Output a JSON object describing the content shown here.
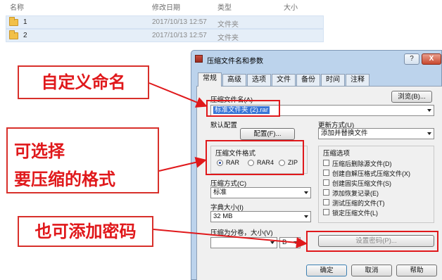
{
  "explorer": {
    "columns": {
      "name": "名称",
      "modified": "修改日期",
      "type": "类型",
      "size": "大小"
    },
    "rows": [
      {
        "name": "1",
        "modified": "2017/10/13 12:57",
        "type": "文件夹"
      },
      {
        "name": "2",
        "modified": "2017/10/13 12:57",
        "type": "文件夹"
      }
    ]
  },
  "dialog": {
    "title": "压缩文件名和参数",
    "help_label": "?",
    "close_label": "X",
    "tabs": [
      "常规",
      "高级",
      "选项",
      "文件",
      "备份",
      "时间",
      "注释"
    ],
    "archive_name_label": "压缩文件名(A)",
    "browse_label": "浏览(B)...",
    "archive_name_value": "标准文件夹 (2).rar",
    "default_profile_label": "默认配置",
    "profile_button_label": "配置(F)...",
    "update_mode_label": "更新方式(U)",
    "update_mode_value": "添加并替换文件",
    "format_group_label": "压缩文件格式",
    "formats": [
      "RAR",
      "RAR4",
      "ZIP"
    ],
    "selected_format": "RAR",
    "method_label": "压缩方式(C)",
    "method_value": "标准",
    "dict_label": "字典大小(I)",
    "dict_value": "32 MB",
    "split_label": "压缩为分卷，大小(V)",
    "split_unit": "B",
    "options_group_label": "压缩选项",
    "options": [
      "压缩后删除源文件(D)",
      "创建自解压格式压缩文件(X)",
      "创建固实压缩文件(S)",
      "添加恢复记录(E)",
      "测试压缩的文件(T)",
      "锁定压缩文件(L)"
    ],
    "password_button_label": "设置密码(P)...",
    "ok_label": "确定",
    "cancel_label": "取消",
    "help_button_label": "帮助"
  },
  "annotations": {
    "custom_name": "自定义命名",
    "choose_line1": "可选择",
    "choose_line2": "要压缩的格式",
    "password": "也可添加密码"
  },
  "colors": {
    "annotation_red": "#e0181b",
    "dialog_frame": "#bcd3ec"
  }
}
